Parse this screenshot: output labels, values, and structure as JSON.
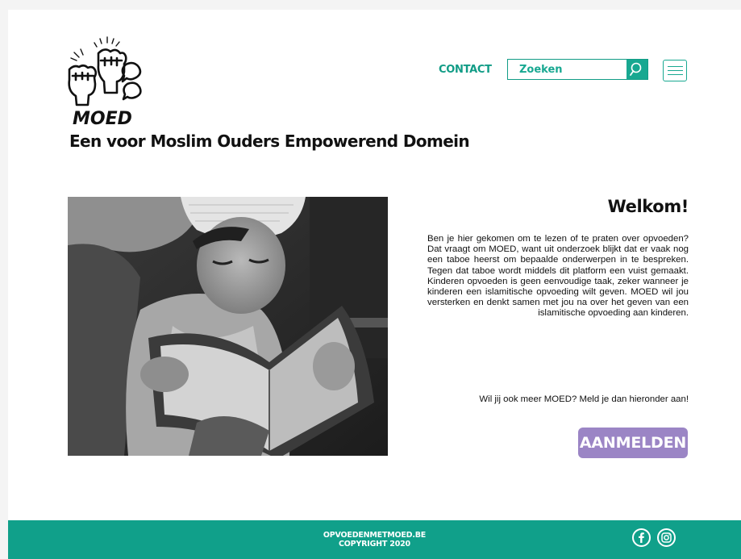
{
  "header": {
    "logo_text": "MOED",
    "tagline": "Een voor Moslim Ouders Empowerend Domein",
    "nav": {
      "contact_label": "CONTACT"
    },
    "search": {
      "placeholder": "Zoeken",
      "value": ""
    }
  },
  "main": {
    "image_alt": "Moeder en kind lezen samen een boek",
    "heading": "Welkom!",
    "intro": "Ben je hier gekomen om te lezen of te praten over opvoeden? Dat vraagt om MOED, want uit onderzoek blijkt dat er vaak nog een taboe heerst om bepaalde onderwerpen in te bespreken. Tegen dat taboe wordt middels dit platform een vuist gemaakt. Kinderen opvoeden is geen eenvoudige taak, zeker wanneer je kinderen een islamitische opvoeding wilt geven. MOED wil jou versterken en denkt samen met jou na over het geven van een islamitische  opvoeding aan kinderen.",
    "cta_text": "Wil jij ook meer MOED? Meld je dan hieronder aan!",
    "signup_label": "AANMELDEN"
  },
  "footer": {
    "site": "OPVOEDENMETMOED.BE",
    "copyright": "COPYRIGHT 2020",
    "social": [
      "facebook-icon",
      "instagram-icon"
    ]
  },
  "colors": {
    "accent": "#10a08a",
    "button": "#9b85c5",
    "text": "#111111",
    "background": "#ffffff"
  }
}
